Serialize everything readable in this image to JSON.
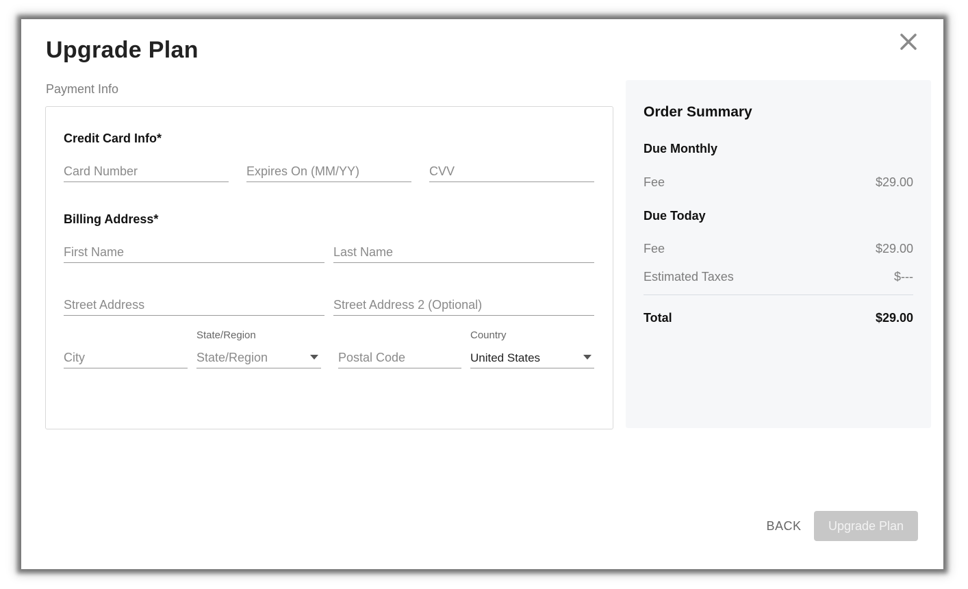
{
  "modal": {
    "title": "Upgrade Plan",
    "close_icon": "close-icon",
    "payment_label": "Payment Info"
  },
  "credit_card": {
    "heading": "Credit Card Info*",
    "card_number_placeholder": "Card Number",
    "expires_placeholder": "Expires On (MM/YY)",
    "cvv_placeholder": "CVV"
  },
  "billing": {
    "heading": "Billing Address*",
    "first_name_placeholder": "First Name",
    "last_name_placeholder": "Last Name",
    "street_placeholder": "Street Address",
    "street2_placeholder": "Street Address 2 (Optional)",
    "city_placeholder": "City",
    "state_label": "State/Region",
    "state_value": "State/Region",
    "postal_placeholder": "Postal Code",
    "country_label": "Country",
    "country_value": "United States"
  },
  "summary": {
    "title": "Order Summary",
    "due_monthly": "Due Monthly",
    "monthly_fee_label": "Fee",
    "monthly_fee_value": "$29.00",
    "due_today": "Due Today",
    "today_fee_label": "Fee",
    "today_fee_value": "$29.00",
    "taxes_label": "Estimated Taxes",
    "taxes_value": "$---",
    "total_label": "Total",
    "total_value": "$29.00"
  },
  "footer": {
    "back_label": "BACK",
    "upgrade_label": "Upgrade Plan"
  },
  "colors": {
    "upgrade_button_disabled": "#c7c7c7",
    "summary_background": "#f6f7f9"
  }
}
